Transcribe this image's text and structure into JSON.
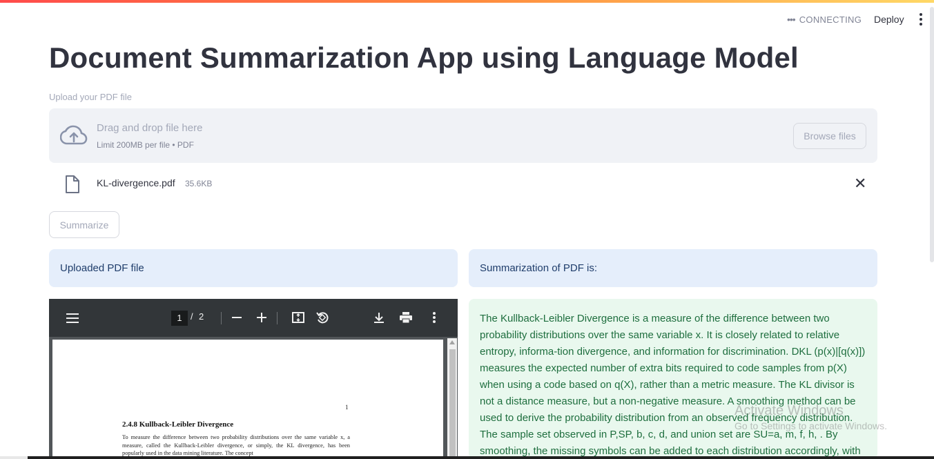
{
  "header": {
    "status_text": "CONNECTING",
    "deploy_label": "Deploy"
  },
  "page": {
    "title": "Document Summarization App using Language Model"
  },
  "uploader": {
    "label": "Upload your PDF file",
    "drop_text": "Drag and drop file here",
    "limit_text": "Limit 200MB per file • PDF",
    "browse_label": "Browse files"
  },
  "file": {
    "name": "KL-divergence.pdf",
    "size": "35.6KB"
  },
  "actions": {
    "summarize_label": "Summarize"
  },
  "panels": {
    "left_title": "Uploaded PDF file",
    "right_title": "Summarization of PDF is:"
  },
  "pdf_viewer": {
    "current_page": "1",
    "separator": "/",
    "total_pages": "2",
    "page_number": "1",
    "heading": "2.4.8    Kullback-Leibler Divergence",
    "body": "To measure the difference between two probability distributions over the same variable x, a measure, called the Kullback-Leibler divergence, or simply, the KL divergence, has been popularly used in the data mining literature. The concept"
  },
  "summary": {
    "text": "The Kullback-Leibler Divergence is a measure of the difference between two probability distributions over the same variable x. It is closely related to relative entropy, informa-tion divergence, and information for discrimination. DKL (p(x)|[q(x)]) measures the expected number of extra bits required to code samples from p(X) when using a code based on q(X), rather than a metric measure. The KL divisor is not a distance measure, but a non-negative measure. A smoothing method can be used to derive the probability distribution from an observed frequency distribution. The sample set observed in P,SP, b, c, d, and union set are SU=a, m, f, h, . By smoothing, the missing symbols can be added to each distribution accordingly, with"
  },
  "watermark": {
    "line1": "Activate Windows",
    "line2": "Go to Settings to activate Windows."
  },
  "colors": {
    "accent": "#ff4b4b",
    "info_bg": "#e5eefb",
    "success_bg": "#e9f8ee",
    "success_text": "#1e6e3e"
  },
  "icons": {
    "status": "dots-icon",
    "menu": "kebab-menu-icon",
    "upload": "cloud-upload-icon",
    "file": "file-icon",
    "remove": "close-icon"
  }
}
